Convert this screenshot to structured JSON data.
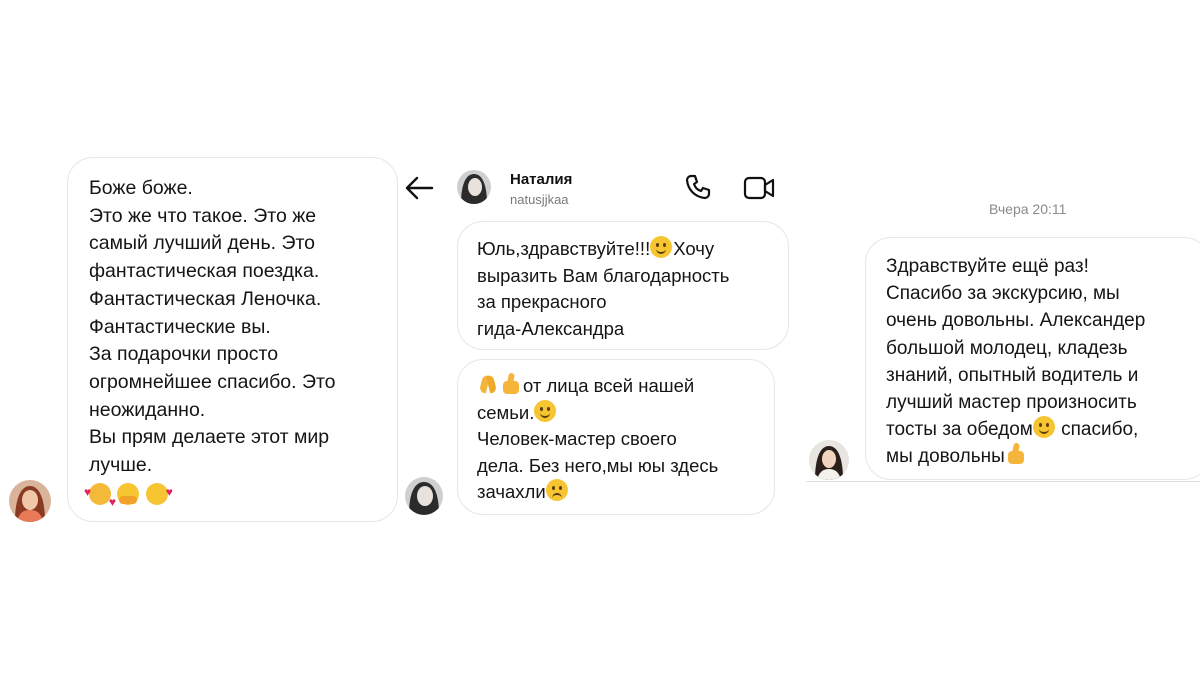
{
  "left_panel": {
    "lines": [
      "Боже боже.",
      "Это же что такое. Это же",
      "самый лучший день. Это",
      "фантастическая поездка.",
      "Фантастическая Леночка.",
      "Фантастические вы.",
      "За подарочки просто",
      "огромнейшее спасибо. Это",
      "неожиданно.",
      "Вы прям делаете этот мир",
      "лучше."
    ],
    "emoji_names": [
      "smiling-face-with-hearts",
      "hugging-face",
      "face-blowing-kiss"
    ]
  },
  "middle_panel": {
    "header": {
      "name": "Наталия",
      "username": "natusjjkaa",
      "icons": [
        "back-arrow-icon",
        "phone-icon",
        "video-call-icon"
      ]
    },
    "message1": {
      "line1_text": "Юль,здравствуйте!!!",
      "line1_after": "Хочу",
      "lines": [
        "выразить Вам благодарность",
        "за прекрасного",
        "гида-Александра"
      ]
    },
    "message2": {
      "line1_text": "от лица всей нашей",
      "line2_text": "семьи.",
      "lines": [
        "Человек-мастер своего",
        "дела. Без него,мы юы здесь"
      ],
      "last_text": "зачахли"
    }
  },
  "right_panel": {
    "timestamp": "Вчера 20:11",
    "lines": [
      "Здравствуйте ещё раз!",
      "Спасибо за экскурсию, мы",
      "очень довольны. Александер",
      "большой молодец, кладезь",
      "знаний, опытный водитель и",
      "лучший мастер произносить"
    ],
    "line7_before": "тосты за обедом",
    "line7_after": " спасибо,",
    "line8_text": "мы довольны"
  }
}
